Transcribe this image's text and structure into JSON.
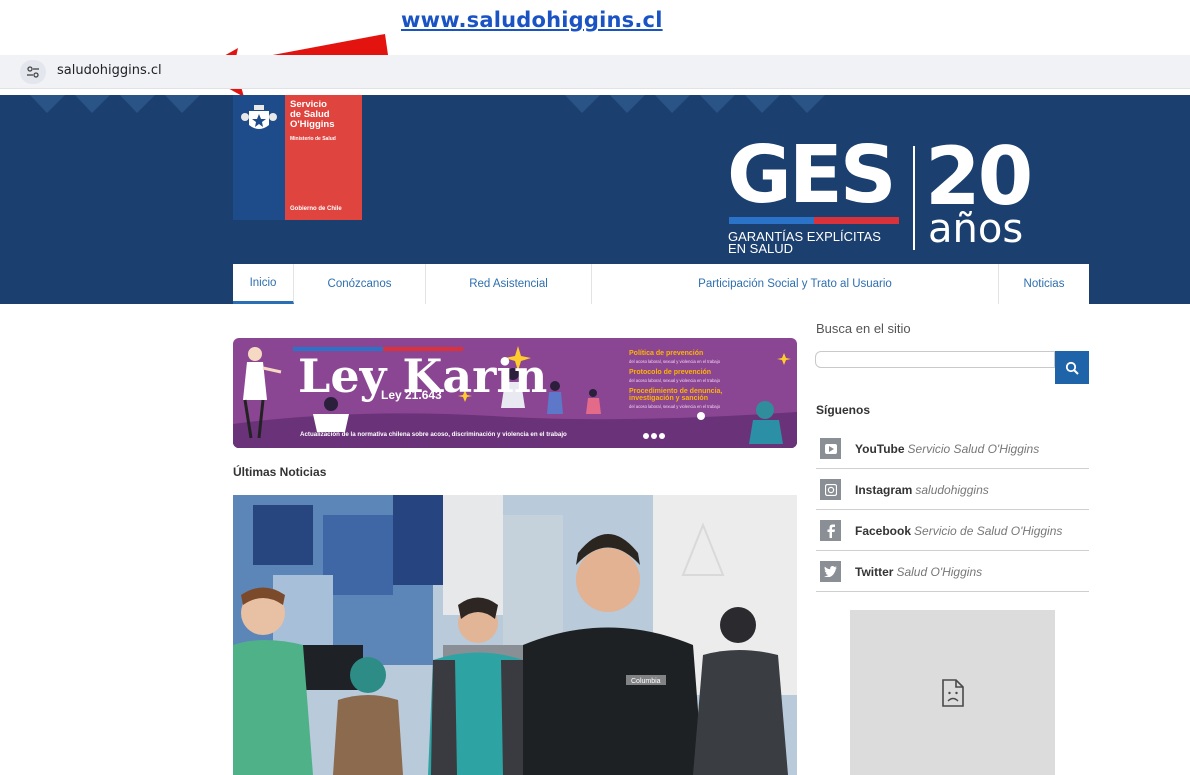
{
  "annotation": {
    "url": "www.saludohiggins.cl"
  },
  "browser": {
    "url": "saludohiggins.cl",
    "site_info_icon": "tune-icon"
  },
  "header": {
    "logo": {
      "name_line1": "Servicio",
      "name_line2": "de Salud",
      "name_line3": "O'Higgins",
      "ministry": "Ministerio de Salud",
      "government": "Gobierno de Chile"
    },
    "campaign": {
      "main": "GES",
      "subtitle_line1": "GARANTÍAS EXPLÍCITAS",
      "subtitle_line2": "EN SALUD",
      "number": "20",
      "years": "años"
    },
    "background_color": "#1b3f6e"
  },
  "nav": {
    "items": [
      {
        "label": "Inicio"
      },
      {
        "label": "Conózcanos"
      },
      {
        "label": "Red Asistencial"
      },
      {
        "label": "Participación Social y Trato al Usuario"
      },
      {
        "label": "Noticias"
      }
    ],
    "link_color": "#2e6fb0"
  },
  "banner": {
    "title": "Ley Karin",
    "law_number": "Ley 21.643",
    "items": [
      {
        "title": "Política de prevención",
        "detail": "del acoso laboral, sexual y violencia en el trabajo"
      },
      {
        "title": "Protocolo de prevención",
        "detail": "del acoso laboral, sexual y violencia en el trabajo"
      },
      {
        "title": "Procedimiento de denuncia, investigación y sanción",
        "detail": "del acoso laboral, sexual y violencia en el trabajo"
      }
    ],
    "footer": "Actualización de la normativa chilena sobre acoso, discriminación y violencia en el trabajo"
  },
  "news": {
    "heading": "Últimas Noticias",
    "photo_logo": "Columbia"
  },
  "sidebar": {
    "search_label": "Busca en el sitio",
    "search_icon": "search-icon",
    "follow_label": "Síguenos",
    "socials": [
      {
        "network": "YouTube",
        "handle": "Servicio Salud O'Higgins",
        "icon": "youtube-icon"
      },
      {
        "network": "Instagram",
        "handle": "saludohiggins",
        "icon": "instagram-icon"
      },
      {
        "network": "Facebook",
        "handle": "Servicio de Salud O'Higgins",
        "icon": "facebook-icon"
      },
      {
        "network": "Twitter",
        "handle": "Salud O'Higgins",
        "icon": "twitter-icon"
      }
    ],
    "widget_icon": "broken-document-icon"
  }
}
